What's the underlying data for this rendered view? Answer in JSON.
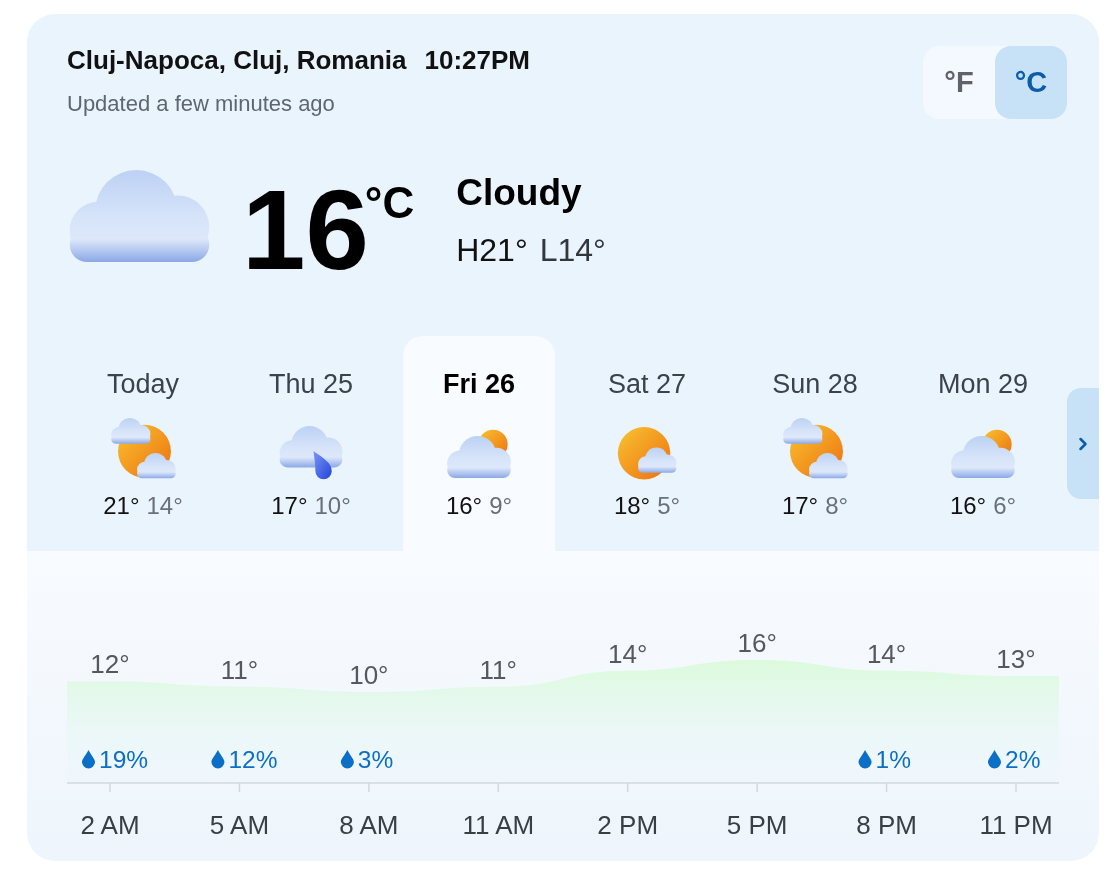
{
  "location": {
    "place": "Cluj-Napoca, Cluj, Romania",
    "time": "10:27PM",
    "updated": "Updated a few minutes ago"
  },
  "units": [
    {
      "label": "°F",
      "selected": false
    },
    {
      "label": "°C",
      "selected": true
    }
  ],
  "current": {
    "kind": "cloud",
    "temperature": "16",
    "unit": "°C",
    "condition": "Cloudy",
    "high": "H21°",
    "low": "L14°"
  },
  "days": [
    {
      "label": "Today",
      "kind": "sun-clouds",
      "high": "21°",
      "low": "14°",
      "selected": false
    },
    {
      "label": "Thu 25",
      "kind": "rain",
      "high": "17°",
      "low": "10°",
      "selected": false
    },
    {
      "label": "Fri 26",
      "kind": "cloud-sun",
      "high": "16°",
      "low": "9°",
      "selected": true
    },
    {
      "label": "Sat 27",
      "kind": "sun-cloud",
      "high": "18°",
      "low": "5°",
      "selected": false
    },
    {
      "label": "Sun 28",
      "kind": "sun-clouds",
      "high": "17°",
      "low": "8°",
      "selected": false
    },
    {
      "label": "Mon 29",
      "kind": "cloud-sun",
      "high": "16°",
      "low": "6°",
      "selected": false
    }
  ],
  "hours": [
    {
      "time": "2 AM",
      "temperature": "12°",
      "precipitation": "19%"
    },
    {
      "time": "5 AM",
      "temperature": "11°",
      "precipitation": "12%"
    },
    {
      "time": "8 AM",
      "temperature": "10°",
      "precipitation": "3%"
    },
    {
      "time": "11 AM",
      "temperature": "11°"
    },
    {
      "time": "2 PM",
      "temperature": "14°"
    },
    {
      "time": "5 PM",
      "temperature": "16°"
    },
    {
      "time": "8 PM",
      "temperature": "14°",
      "precipitation": "1%"
    },
    {
      "time": "11 PM",
      "temperature": "13°",
      "precipitation": "2%"
    }
  ]
}
